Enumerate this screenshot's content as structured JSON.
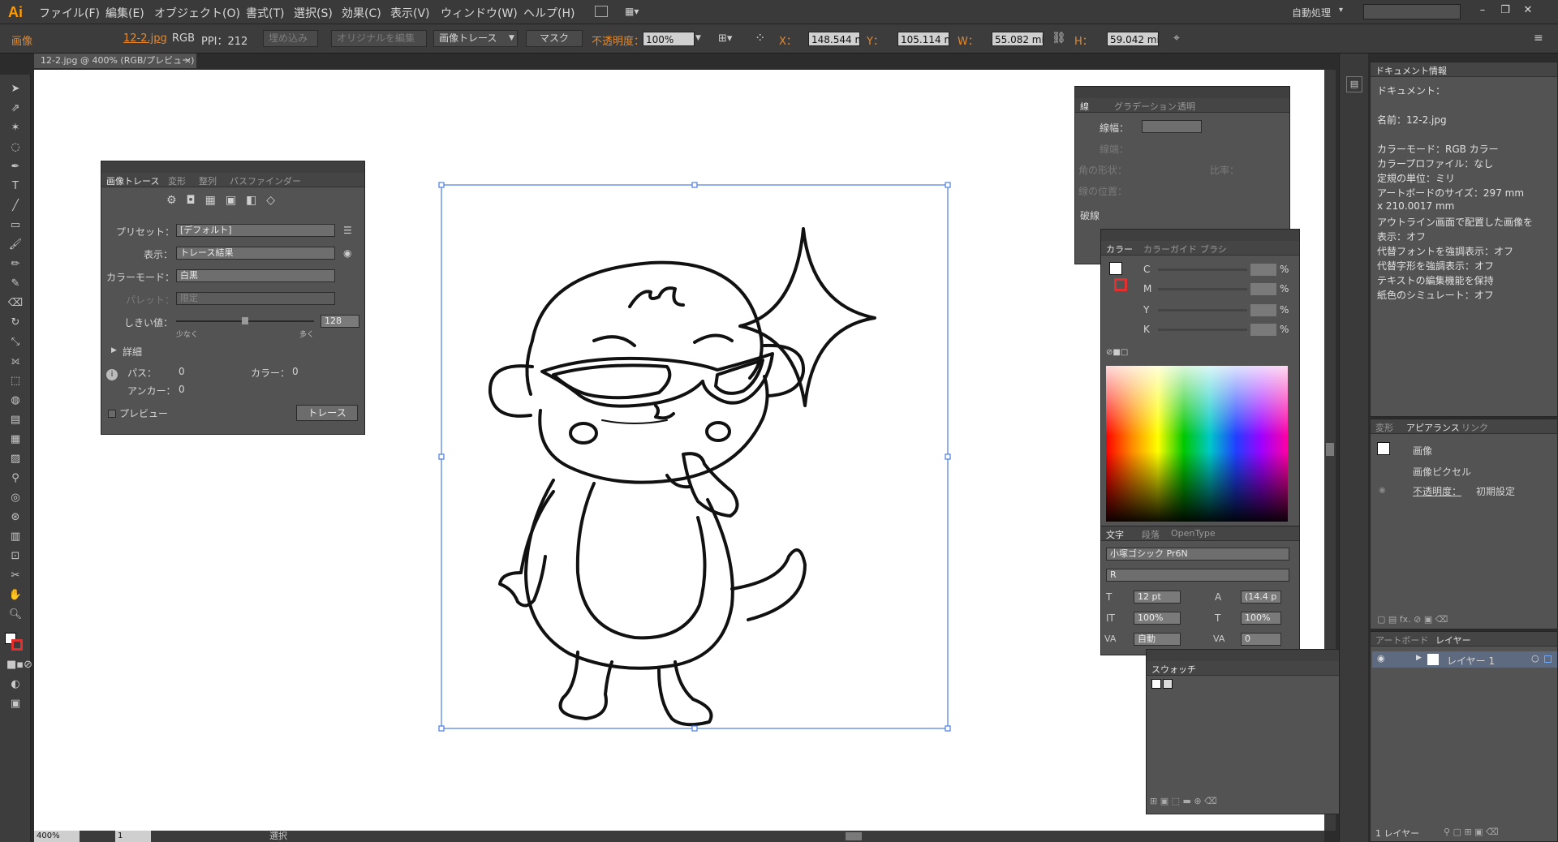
{
  "app": {
    "logo": "Ai"
  },
  "menu": [
    "ファイル(F)",
    "編集(E)",
    "オブジェクト(O)",
    "書式(T)",
    "選択(S)",
    "効果(C)",
    "表示(V)",
    "ウィンドウ(W)",
    "ヘルプ(H)"
  ],
  "workspace": "自動処理",
  "window_buttons": [
    "–",
    "❐",
    "✕"
  ],
  "control": {
    "object_type": "画像",
    "file_link": "12-2.jpg",
    "color_mode": "RGB",
    "ppi": "PPI：212",
    "embed_btn": "埋め込み",
    "edit_original_btn": "オリジナルを編集",
    "image_trace_btn": "画像トレース",
    "mask_btn": "マスク",
    "opacity_label": "不透明度：",
    "opacity_value": "100%",
    "x_label": "X：",
    "x_value": "148.544 m",
    "y_label": "Y：",
    "y_value": "105.114 m",
    "w_label": "W：",
    "w_value": "55.082 mi",
    "h_label": "H：",
    "h_value": "59.042 mi"
  },
  "doc_tab": {
    "title": "12-2.jpg @ 400% (RGB/プレビュー)",
    "close": "×"
  },
  "trace_panel": {
    "tabs": [
      "画像トレース",
      "変形",
      "整列",
      "パスファインダー"
    ],
    "preset_label": "プリセット：",
    "preset_value": "[デフォルト]",
    "view_label": "表示：",
    "view_value": "トレース結果",
    "mode_label": "カラーモード：",
    "mode_value": "白黒",
    "palette_label": "パレット：",
    "palette_value": "限定",
    "threshold_label": "しきい値：",
    "threshold_value": "128",
    "threshold_level": 0.5,
    "slider_less": "少なく",
    "slider_more": "多く",
    "details_label": "詳細",
    "paths_label": "パス：",
    "paths_value": "0",
    "colors_label": "カラー：",
    "colors_value": "0",
    "anchors_label": "アンカー：",
    "anchors_value": "0",
    "preview_label": "プレビュー",
    "trace_button": "トレース"
  },
  "stroke_panel": {
    "tabs": [
      "線",
      "グラデーション",
      "透明"
    ],
    "weight_label": "線幅：",
    "cap_label": "線端：",
    "corner_label": "角の形状：",
    "limit_label": "比率：",
    "align_label": "線の位置：",
    "dashed_label": "破線"
  },
  "color_panel": {
    "tabs": [
      "カラー",
      "カラーガイド",
      "ブラシ"
    ],
    "channels": [
      "C",
      "M",
      "Y",
      "K"
    ],
    "unit": "%"
  },
  "char_panel": {
    "tabs": [
      "文字",
      "段落",
      "OpenType"
    ],
    "font_family": "小塚ゴシック Pr6N",
    "font_style": "R",
    "size": "12 pt",
    "leading": "(14.4 p",
    "vscale": "100%",
    "hscale": "100%",
    "kerning": "自動",
    "tracking": "0"
  },
  "swatches_panel": {
    "tab": "スウォッチ"
  },
  "doc_info": {
    "tab": "ドキュメント情報",
    "lines": [
      "ドキュメント：",
      "",
      "名前：12-2.jpg",
      "",
      "カラーモード：RGB カラー",
      "カラープロファイル：なし",
      "定規の単位：ミリ",
      "アートボードのサイズ：297 mm",
      "x 210.0017 mm",
      "アウトライン画面で配置した画像を",
      "表示：オフ",
      "代替フォントを強調表示：オフ",
      "代替字形を強調表示：オフ",
      "テキストの編集機能を保持",
      "紙色のシミュレート：オフ"
    ]
  },
  "appearance_panel": {
    "tabs": [
      "変形",
      "アピアランス",
      "リンク"
    ],
    "title": "画像",
    "row1": "画像ピクセル",
    "opacity_label": "不透明度：",
    "opacity_value": "初期設定"
  },
  "layers_panel": {
    "tabs": [
      "アートボード",
      "レイヤー"
    ],
    "layer_name": "レイヤー 1",
    "footer": "1 レイヤー"
  },
  "status": {
    "zoom": "400%",
    "page": "1",
    "tool": "選択"
  }
}
